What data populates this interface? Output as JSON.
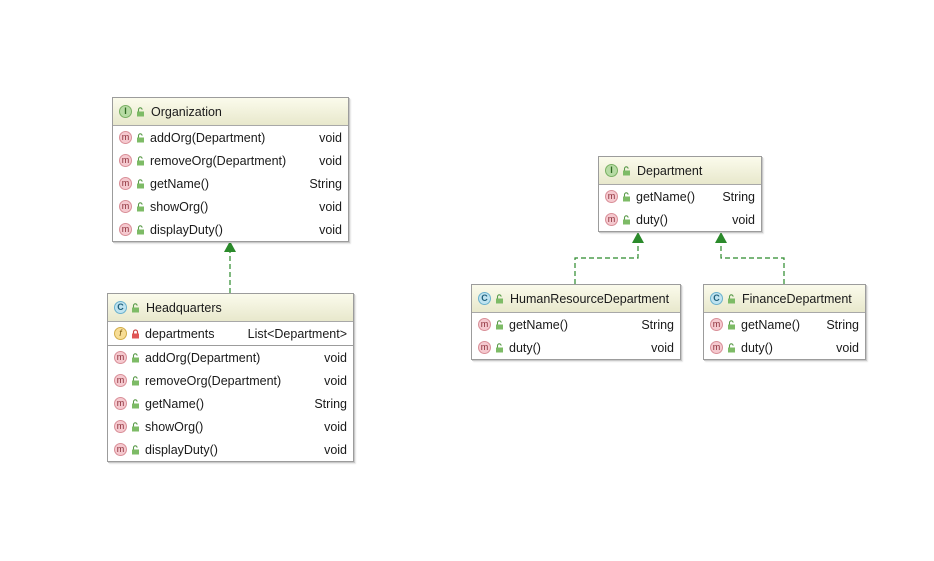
{
  "colors": {
    "arrow": "#2b8a2b",
    "header_top": "#fbfbec",
    "header_bottom": "#e8e8cc",
    "border": "#9c9c9c"
  },
  "boxes": [
    {
      "id": "organization",
      "kind": "interface",
      "badge": "I",
      "name": "Organization",
      "fields": [],
      "methods": [
        {
          "badge": "m",
          "name": "addOrg(Department)",
          "type": "void"
        },
        {
          "badge": "m",
          "name": "removeOrg(Department)",
          "type": "void"
        },
        {
          "badge": "m",
          "name": "getName()",
          "type": "String"
        },
        {
          "badge": "m",
          "name": "showOrg()",
          "type": "void"
        },
        {
          "badge": "m",
          "name": "displayDuty()",
          "type": "void"
        }
      ]
    },
    {
      "id": "headquarters",
      "kind": "class",
      "badge": "C",
      "name": "Headquarters",
      "fields": [
        {
          "badge": "f",
          "name": "departments",
          "type": "List<Department>",
          "visibility": "private"
        }
      ],
      "methods": [
        {
          "badge": "m",
          "name": "addOrg(Department)",
          "type": "void"
        },
        {
          "badge": "m",
          "name": "removeOrg(Department)",
          "type": "void"
        },
        {
          "badge": "m",
          "name": "getName()",
          "type": "String"
        },
        {
          "badge": "m",
          "name": "showOrg()",
          "type": "void"
        },
        {
          "badge": "m",
          "name": "displayDuty()",
          "type": "void"
        }
      ]
    },
    {
      "id": "department",
      "kind": "interface",
      "badge": "I",
      "name": "Department",
      "fields": [],
      "methods": [
        {
          "badge": "m",
          "name": "getName()",
          "type": "String"
        },
        {
          "badge": "m",
          "name": "duty()",
          "type": "void"
        }
      ]
    },
    {
      "id": "human-resource-department",
      "kind": "class",
      "badge": "C",
      "name": "HumanResourceDepartment",
      "fields": [],
      "methods": [
        {
          "badge": "m",
          "name": "getName()",
          "type": "String"
        },
        {
          "badge": "m",
          "name": "duty()",
          "type": "void"
        }
      ]
    },
    {
      "id": "finance-department",
      "kind": "class",
      "badge": "C",
      "name": "FinanceDepartment",
      "fields": [],
      "methods": [
        {
          "badge": "m",
          "name": "getName()",
          "type": "String"
        },
        {
          "badge": "m",
          "name": "duty()",
          "type": "void"
        }
      ]
    }
  ],
  "relations": [
    {
      "from": "headquarters",
      "to": "organization",
      "type": "implements"
    },
    {
      "from": "human-resource-department",
      "to": "department",
      "type": "implements"
    },
    {
      "from": "finance-department",
      "to": "department",
      "type": "implements"
    }
  ]
}
